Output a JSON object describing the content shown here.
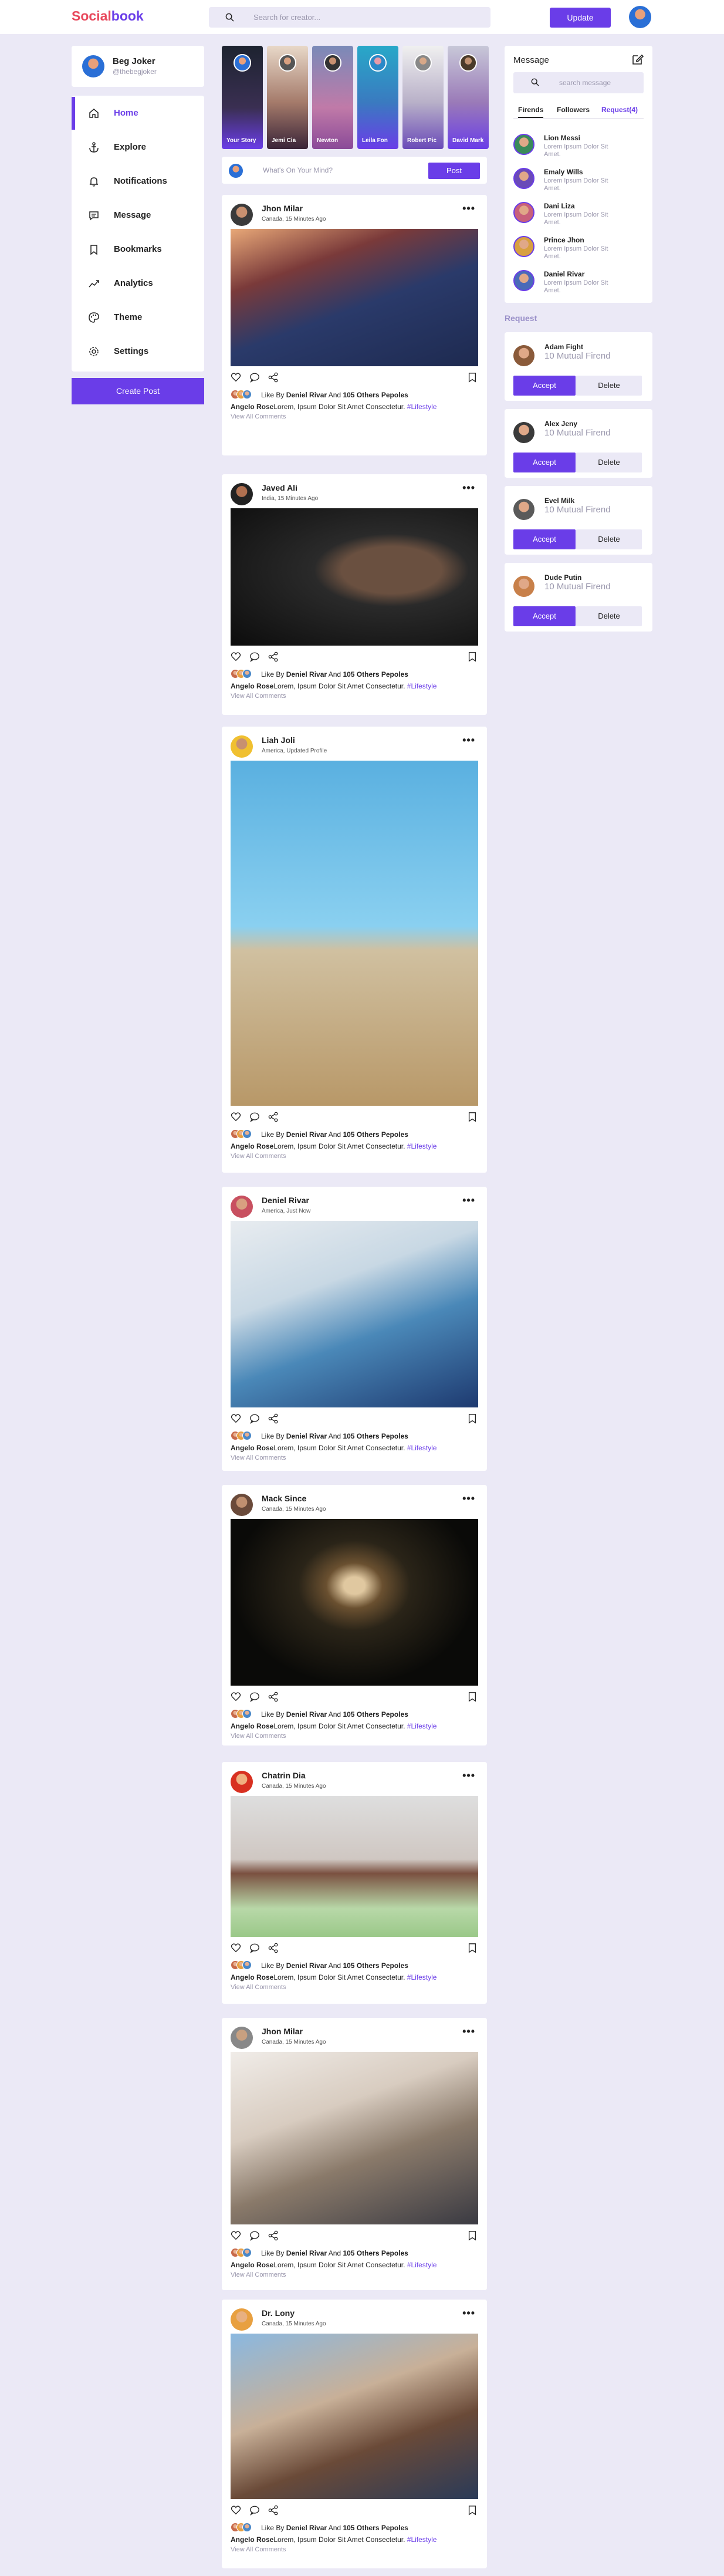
{
  "brand": {
    "part1": "Social",
    "part2": "book"
  },
  "search": {
    "placeholder": "Search for creator..."
  },
  "topbar": {
    "update_label": "Update"
  },
  "profile": {
    "name": "Beg Joker",
    "handle": "@thebegjoker"
  },
  "sidebar": {
    "items": [
      {
        "label": "Home",
        "icon": "home-icon"
      },
      {
        "label": "Explore",
        "icon": "anchor-icon"
      },
      {
        "label": "Notifications",
        "icon": "bell-icon"
      },
      {
        "label": "Message",
        "icon": "chat-icon"
      },
      {
        "label": "Bookmarks",
        "icon": "bookmark-icon"
      },
      {
        "label": "Analytics",
        "icon": "chart-icon"
      },
      {
        "label": "Theme",
        "icon": "palette-icon"
      },
      {
        "label": "Settings",
        "icon": "gear-icon"
      }
    ],
    "create_label": "Create Post"
  },
  "stories": [
    {
      "name": "Your Story"
    },
    {
      "name": "Jemi Cia"
    },
    {
      "name": "Newton"
    },
    {
      "name": "Leila Fon"
    },
    {
      "name": "Robert Pic"
    },
    {
      "name": "David Mark"
    }
  ],
  "composer": {
    "placeholder": "What's On Your Mind?",
    "post_label": "Post"
  },
  "common": {
    "like_prefix": "Like By",
    "liker": "Deniel Rivar",
    "and": "And",
    "others": "105 Others Pepoles",
    "commenter": "Angelo Rose",
    "comment": "Lorem, Ipsum Dolor Sit Amet Consectetur.",
    "tag": "#Lifestyle",
    "view_all": "View All Comments",
    "dots": "•••"
  },
  "posts": [
    {
      "author": "Jhon Milar",
      "location": "Canada, 15 Minutes Ago"
    },
    {
      "author": "Javed Ali",
      "location": "India, 15 Minutes Ago"
    },
    {
      "author": "Liah Joli",
      "location": "America, Updated Profile"
    },
    {
      "author": "Deniel Rivar",
      "location": "America, Just Now"
    },
    {
      "author": "Mack Since",
      "location": "Canada, 15 Minutes Ago"
    },
    {
      "author": "Chatrin Dia",
      "location": "Canada, 15 Minutes Ago"
    },
    {
      "author": "Jhon Milar",
      "location": "Canada, 15 Minutes Ago"
    },
    {
      "author": "Dr. Lony",
      "location": "Canada, 15 Minutes Ago"
    }
  ],
  "messages": {
    "title": "Message",
    "search_placeholder": "search message",
    "tabs": [
      "Firends",
      "Followers",
      "Request(4)"
    ],
    "contacts": [
      {
        "name": "Lion Messi",
        "msg": "Lorem Ipsum Dolor Sit Amet."
      },
      {
        "name": "Emaly Wills",
        "msg": "Lorem Ipsum Dolor Sit Amet."
      },
      {
        "name": "Dani Liza",
        "msg": "Lorem Ipsum Dolor Sit Amet."
      },
      {
        "name": "Prince Jhon",
        "msg": "Lorem Ipsum Dolor Sit Amet."
      },
      {
        "name": "Daniel Rivar",
        "msg": "Lorem Ipsum Dolor Sit Amet."
      }
    ]
  },
  "requests": {
    "heading": "Request",
    "accept_label": "Accept",
    "delete_label": "Delete",
    "items": [
      {
        "name": "Adam Fight",
        "mutual": "10 Mutual Firend"
      },
      {
        "name": "Alex Jeny",
        "mutual": "10 Mutual Firend"
      },
      {
        "name": "Evel Milk",
        "mutual": "10 Mutual Firend"
      },
      {
        "name": "Dude Putin",
        "mutual": "10 Mutual Firend"
      }
    ]
  },
  "colors": {
    "accent": "#6a3de8",
    "brand_red": "#e8485c",
    "background": "#ebe9f6"
  }
}
